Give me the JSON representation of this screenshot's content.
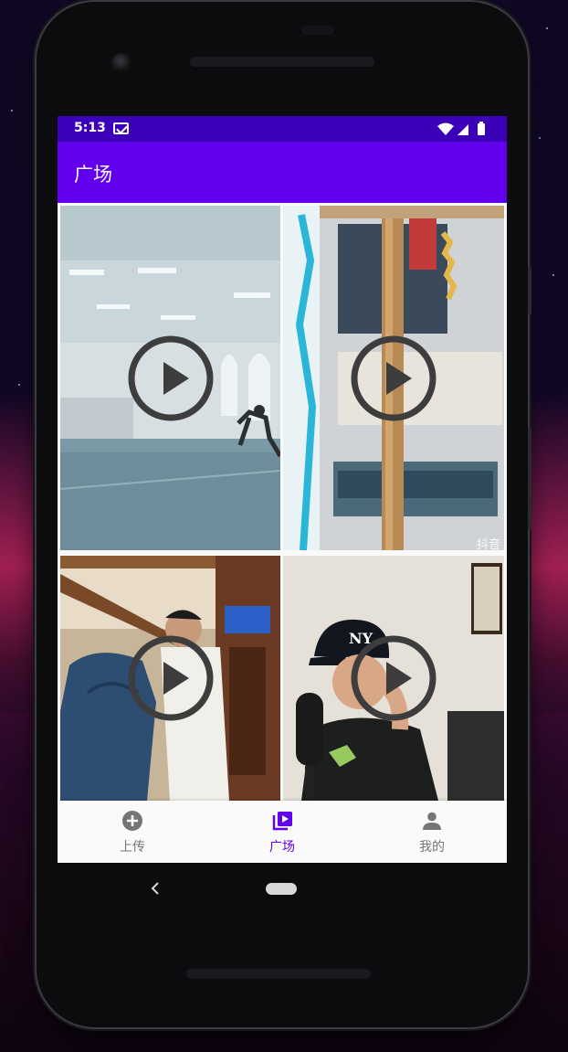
{
  "status_bar": {
    "time": "5:13"
  },
  "app_bar": {
    "title": "广场"
  },
  "videos": [
    {
      "play_icon": "play-circle-icon"
    },
    {
      "play_icon": "play-circle-icon",
      "watermark": "抖音"
    },
    {
      "play_icon": "play-circle-icon"
    },
    {
      "play_icon": "play-circle-icon"
    }
  ],
  "bottom_nav": {
    "items": [
      {
        "label": "上传",
        "icon": "add-circle-icon",
        "active": false
      },
      {
        "label": "广场",
        "icon": "video-library-icon",
        "active": true
      },
      {
        "label": "我的",
        "icon": "person-icon",
        "active": false
      }
    ]
  },
  "colors": {
    "status_bar": "#3b00b8",
    "app_bar": "#6200ee",
    "nav_active": "#6200ee",
    "nav_inactive": "#757575"
  }
}
